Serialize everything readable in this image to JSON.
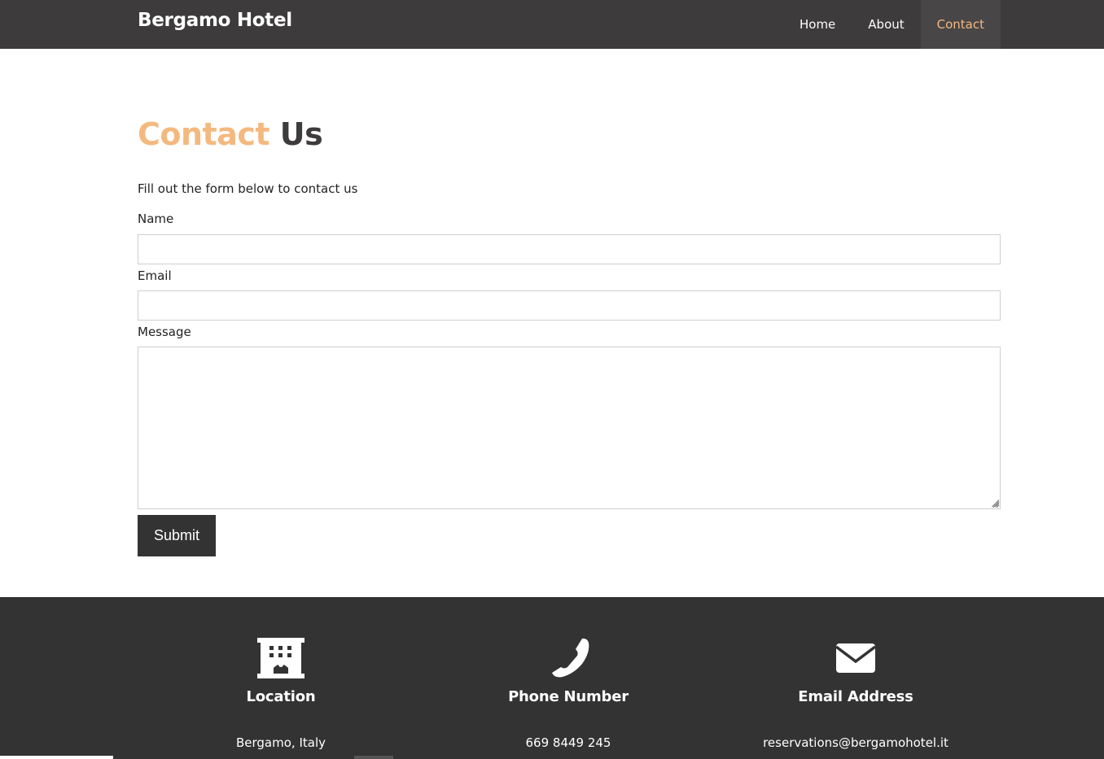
{
  "header": {
    "brand": "Bergamo Hotel",
    "nav": [
      {
        "label": "Home"
      },
      {
        "label": "About"
      },
      {
        "label": "Contact",
        "active": true
      }
    ]
  },
  "main": {
    "heading_accent": "Contact",
    "heading_rest": "Us",
    "intro": "Fill out the form below to contact us",
    "form": {
      "name_label": "Name",
      "name_value": "",
      "email_label": "Email",
      "email_value": "",
      "message_label": "Message",
      "message_value": "",
      "submit_label": "Submit"
    }
  },
  "footer": {
    "columns": [
      {
        "icon": "building-icon",
        "title": "Location",
        "value": "Bergamo, Italy"
      },
      {
        "icon": "phone-icon",
        "title": "Phone Number",
        "value": "669 8449 245"
      },
      {
        "icon": "envelope-icon",
        "title": "Email Address",
        "value": "reservations@bergamohotel.it"
      }
    ]
  },
  "colors": {
    "accent": "#f4b97f",
    "navbar": "#3d3b3c",
    "footer": "#333333"
  }
}
